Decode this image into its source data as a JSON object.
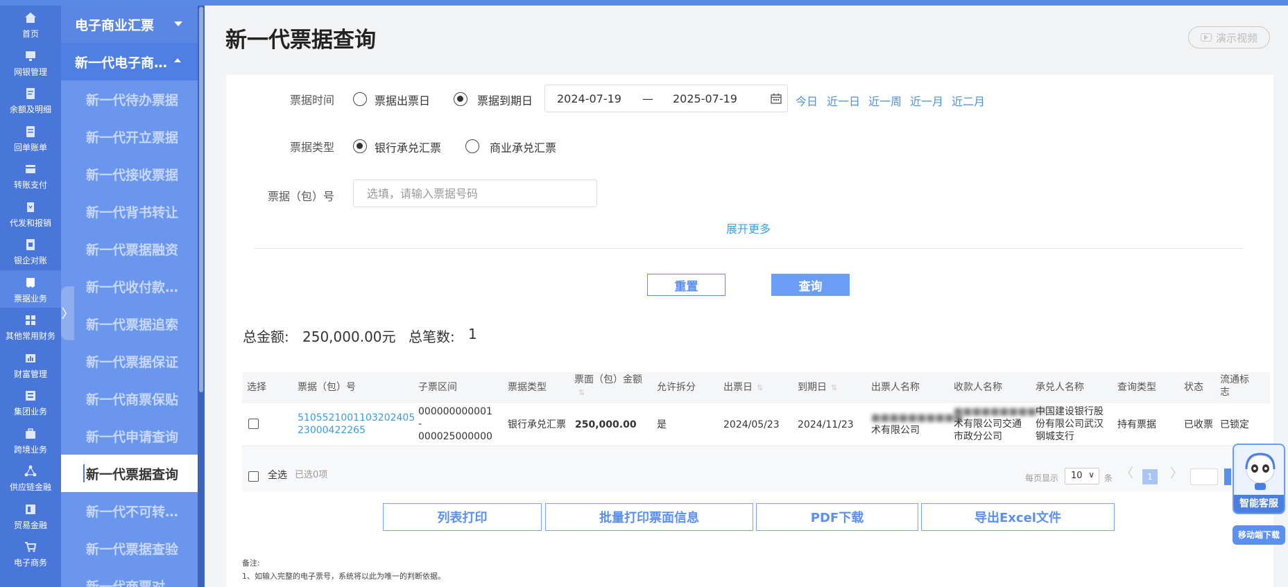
{
  "sidebar": {
    "items": [
      {
        "label": "首页",
        "icon": "home-icon"
      },
      {
        "label": "网银管理",
        "icon": "monitor-icon"
      },
      {
        "label": "余额及明细",
        "icon": "document-icon"
      },
      {
        "label": "回单账单",
        "icon": "receipt-icon"
      },
      {
        "label": "转账支付",
        "icon": "wallet-icon"
      },
      {
        "label": "代发和报销",
        "icon": "payroll-icon"
      },
      {
        "label": "银企对账",
        "icon": "reconcile-icon"
      },
      {
        "label": "票据业务",
        "icon": "bill-icon"
      },
      {
        "label": "其他常用财务",
        "icon": "grid-icon"
      },
      {
        "label": "财富管理",
        "icon": "chart-icon"
      },
      {
        "label": "集团业务",
        "icon": "group-icon"
      },
      {
        "label": "跨境业务",
        "icon": "briefcase-icon"
      },
      {
        "label": "供应链金融",
        "icon": "network-icon"
      },
      {
        "label": "贸易金融",
        "icon": "trade-icon"
      },
      {
        "label": "电子商务",
        "icon": "cart-icon"
      }
    ]
  },
  "menu": {
    "group": "电子商业汇票",
    "subgroup": "新一代电子商…",
    "items": [
      "新一代待办票据",
      "新一代开立票据",
      "新一代接收票据",
      "新一代背书转让",
      "新一代票据融资",
      "新一代收付款…",
      "新一代票据追索",
      "新一代票据保证",
      "新一代商票保贴",
      "新一代申请查询",
      "新一代票据查询",
      "新一代不可转…",
      "新一代票据查验",
      "新一代商票对…"
    ]
  },
  "page": {
    "title": "新一代票据查询",
    "demo_video": "演示视频"
  },
  "form": {
    "date_label": "票据时间",
    "date_opt1": "票据出票日",
    "date_opt2": "票据到期日",
    "date_from": "2024-07-19",
    "date_sep": "—",
    "date_to": "2025-07-19",
    "quick": [
      "今日",
      "近一日",
      "近一周",
      "近一月",
      "近二月"
    ],
    "type_label": "票据类型",
    "type_opt1": "银行承兑汇票",
    "type_opt2": "商业承兑汇票",
    "number_label": "票据（包）号",
    "number_placeholder": "选填，请输入票据号码",
    "expand": "展开更多",
    "reset": "重置",
    "query": "查询"
  },
  "summary": {
    "total_amount_label": "总金额:",
    "total_amount": "250,000.00元",
    "total_count_label": "总笔数:",
    "total_count": "1"
  },
  "table": {
    "headers": [
      "选择",
      "票据（包）号",
      "子票区间",
      "票据类型",
      "票面（包）金额",
      "允许拆分",
      "出票日",
      "到期日",
      "出票人名称",
      "收款人名称",
      "承兑人名称",
      "查询类型",
      "状态",
      "流通标志"
    ],
    "row": {
      "number_line1": "510552100110320240​5",
      "number_line2": "23000422265",
      "range_line1": "000000000001",
      "range_line2": "-",
      "range_line3": "000025000000",
      "type": "银行承兑汇票",
      "amount": "250,000.00",
      "split": "是",
      "issue_date": "2024/05/23",
      "due_date": "2024/11/23",
      "drawer_line1": "■■■■■■■■■■",
      "drawer_line2": "术有限公司",
      "payee_line1": "■■■■■■■■■技",
      "payee_line2": "术有限公司交通",
      "payee_line3": "市政分公司",
      "acceptor_line1": "中国建设银行股",
      "acceptor_line2": "份有限公司武汉",
      "acceptor_line3": "钢城支行",
      "query_type": "持有票据",
      "status": "已收票",
      "flow": "已锁定"
    },
    "select_all": "全选",
    "selected": "已选0项",
    "per_page_label": "每页显示",
    "per_page": "10",
    "per_page_unit": "条",
    "current_page": "1"
  },
  "actions": {
    "print_list": "列表打印",
    "batch_print": "批量打印票面信息",
    "pdf": "PDF下载",
    "excel": "导出Excel文件"
  },
  "notes": {
    "title": "备注:",
    "line1": "1、如输入完整的电子票号，系统将以此为唯一的判断依据。"
  },
  "floating": {
    "service": "智能客服",
    "download": "移动端下载"
  }
}
